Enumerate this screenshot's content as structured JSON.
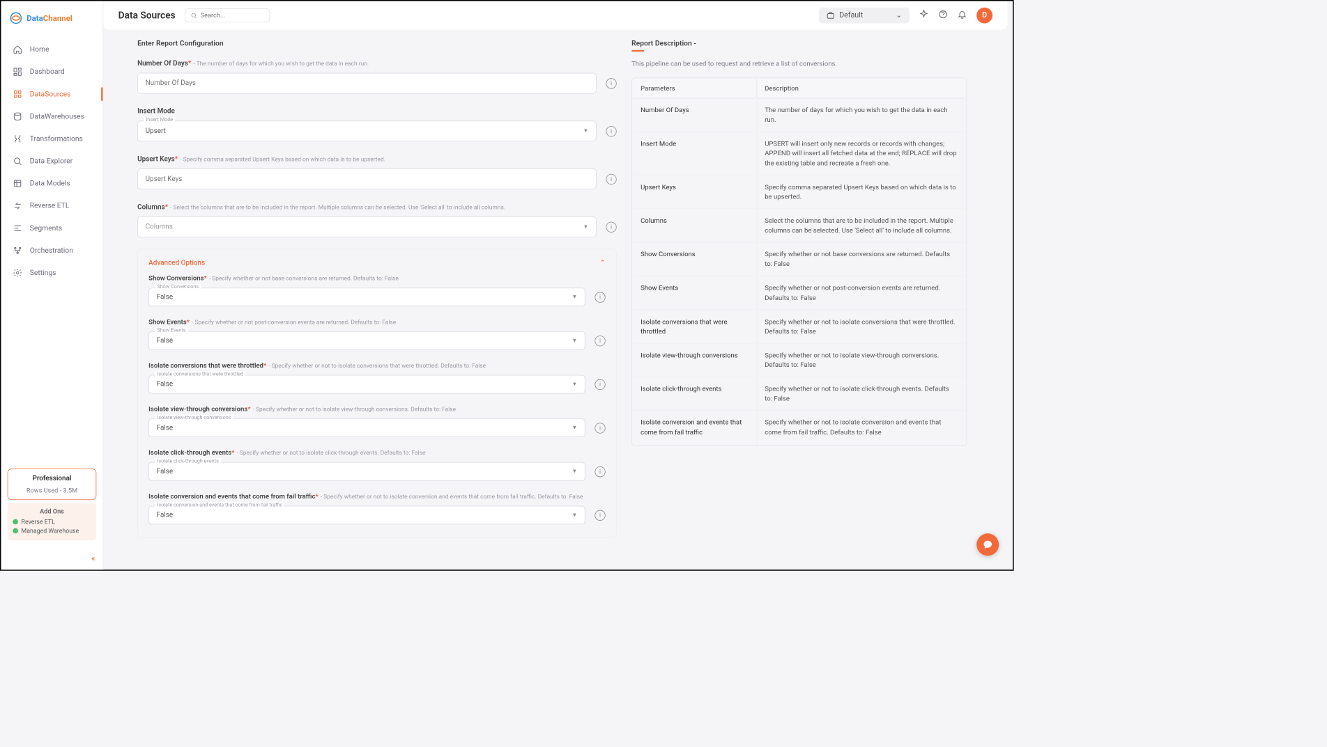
{
  "brand": {
    "part1": "Data",
    "part2": "Channel"
  },
  "page_title": "Data Sources",
  "search": {
    "placeholder": "Search..."
  },
  "workspace": {
    "selected": "Default"
  },
  "avatar": {
    "initial": "D"
  },
  "sidebar": {
    "items": [
      {
        "label": "Home"
      },
      {
        "label": "Dashboard"
      },
      {
        "label": "DataSources"
      },
      {
        "label": "DataWarehouses"
      },
      {
        "label": "Transformations"
      },
      {
        "label": "Data Explorer"
      },
      {
        "label": "Data Models"
      },
      {
        "label": "Reverse ETL"
      },
      {
        "label": "Segments"
      },
      {
        "label": "Orchestration"
      },
      {
        "label": "Settings"
      }
    ],
    "plan": {
      "name": "Professional",
      "rows": "Rows Used - 3.5M"
    },
    "addons": {
      "title": "Add Ons",
      "items": [
        "Reverse ETL",
        "Managed Warehouse"
      ]
    }
  },
  "form": {
    "section_title": "Enter Report Configuration",
    "number_of_days": {
      "label": "Number Of Days",
      "placeholder": "Number Of Days",
      "help": "- The number of days for which you wish to get the data in each run."
    },
    "insert_mode": {
      "label": "Insert Mode",
      "float": "Insert Mode",
      "value": "Upsert"
    },
    "upsert_keys": {
      "label": "Upsert Keys",
      "placeholder": "Upsert Keys",
      "help": "- Specify comma separated Upsert Keys based on which data is to be upserted."
    },
    "columns": {
      "label": "Columns",
      "placeholder": "Columns",
      "help": "- Select the columns that are to be included in the report. Multiple columns can be selected. Use 'Select all' to include all columns."
    },
    "advanced_label": "Advanced Options",
    "advanced": [
      {
        "label": "Show Conversions",
        "help": "- Specify whether or not base conversions are returned. Defaults to: False",
        "float": "Show Conversions",
        "value": "False"
      },
      {
        "label": "Show Events",
        "help": "- Specify whether or not post-conversion events are returned. Defaults to: False",
        "float": "Show Events",
        "value": "False"
      },
      {
        "label": "Isolate conversions that were throttled",
        "help": "- Specify whether or not to isolate conversions that were throttled. Defaults to: False",
        "float": "Isolate conversions that were throttled",
        "value": "False"
      },
      {
        "label": "Isolate view-through conversions",
        "help": "- Specify whether or not to isolate view-through conversions. Defaults to: False",
        "float": "Isolate view-through conversions",
        "value": "False"
      },
      {
        "label": "Isolate click-through events",
        "help": "- Specify whether or not to isolate click-through events. Defaults to: False",
        "float": "Isolate click-through events",
        "value": "False"
      },
      {
        "label": "Isolate conversion and events that come from fail traffic",
        "help": "- Specify whether or not to isolate conversion and events that come from fail traffic. Defaults to: False",
        "float": "Isolate conversion and events that come from fail traffic",
        "value": "False"
      }
    ]
  },
  "description": {
    "title": "Report Description -",
    "text": "This pipeline can be used to request and retrieve a list of conversions.",
    "headers": [
      "Parameters",
      "Description"
    ],
    "rows": [
      [
        "Number Of Days",
        "The number of days for which you wish to get the data in each run."
      ],
      [
        "Insert Mode",
        "UPSERT will insert only new records or records with changes; APPEND will insert all fetched data at the end; REPLACE will drop the existing table and recreate a fresh one."
      ],
      [
        "Upsert Keys",
        "Specify comma separated Upsert Keys based on which data is to be upserted."
      ],
      [
        "Columns",
        "Select the columns that are to be included in the report. Multiple columns can be selected. Use 'Select all' to include all columns."
      ],
      [
        "Show Conversions",
        "Specify whether or not base conversions are returned. Defaults to: False"
      ],
      [
        "Show Events",
        "Specify whether or not post-conversion events are returned. Defaults to: False"
      ],
      [
        "Isolate conversions that were throttled",
        "Specify whether or not to isolate conversions that were throttled. Defaults to: False"
      ],
      [
        "Isolate view-through conversions",
        "Specify whether or not to isolate view-through conversions. Defaults to: False"
      ],
      [
        "Isolate click-through events",
        "Specify whether or not to isolate click-through events. Defaults to: False"
      ],
      [
        "Isolate conversion and events that come from fail traffic",
        "Specify whether or not to isolate conversion and events that come from fail traffic. Defaults to: False"
      ]
    ]
  }
}
